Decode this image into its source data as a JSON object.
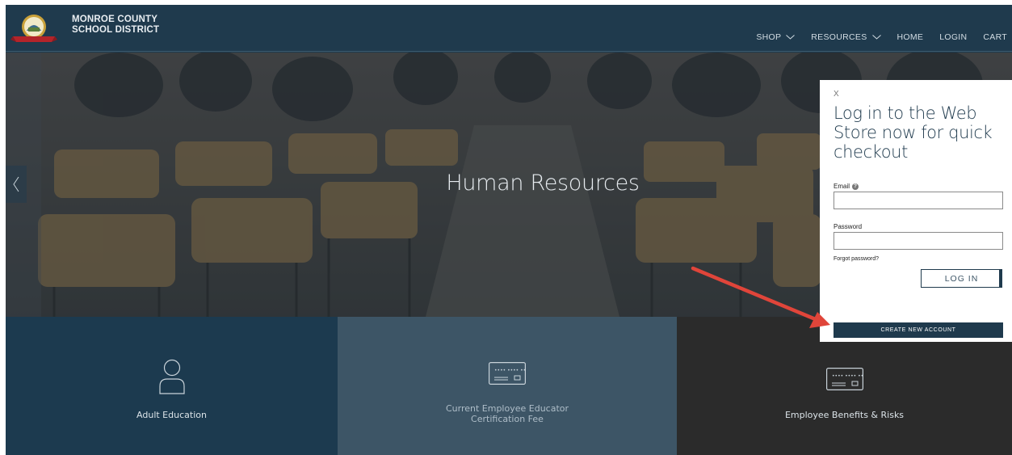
{
  "header": {
    "brand_line1": "MONROE COUNTY",
    "brand_line2": "SCHOOL DISTRICT",
    "nav": [
      {
        "label": "SHOP",
        "dropdown": true
      },
      {
        "label": "RESOURCES",
        "dropdown": true
      },
      {
        "label": "HOME",
        "dropdown": false
      },
      {
        "label": "LOGIN",
        "dropdown": false
      },
      {
        "label": "CART",
        "dropdown": false
      }
    ]
  },
  "hero": {
    "title": "Human Resources",
    "prev_icon": "chevron-left-icon"
  },
  "tiles": [
    {
      "label": "Adult Education",
      "icon": "person-icon"
    },
    {
      "label": "Current Employee Educator Certification Fee",
      "icon": "credit-card-icon"
    },
    {
      "label": "Employee Benefits & Risks",
      "icon": "credit-card-icon"
    }
  ],
  "login": {
    "close_label": "X",
    "title": "Log in to the Web Store now for quick checkout",
    "email_label": "Email",
    "email_value": "",
    "password_label": "Password",
    "password_value": "",
    "forgot_label": "Forgot password?",
    "login_button": "LOG IN",
    "create_button": "CREATE NEW ACCOUNT"
  },
  "colors": {
    "header_bg": "#1f3a4d",
    "tile_1": "#1c3a4f",
    "tile_2": "#3d5566",
    "tile_3": "#2b2b2b",
    "annotation_arrow": "#e0453a"
  }
}
